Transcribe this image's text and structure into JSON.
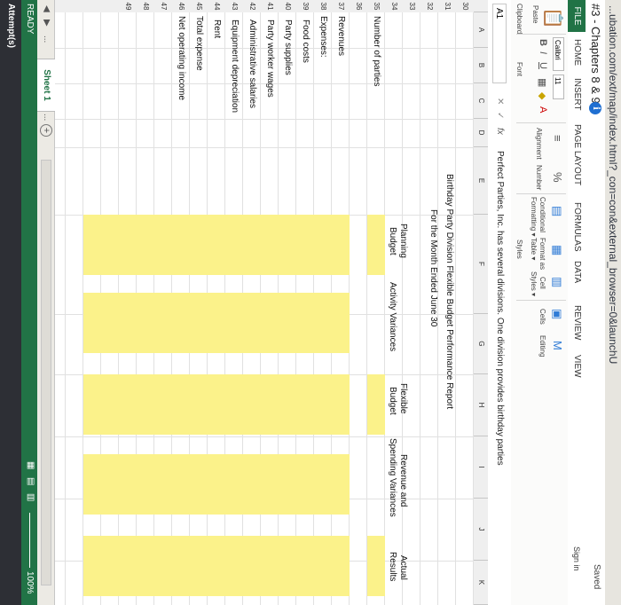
{
  "browser": {
    "url": "...ubation.com/ext/map/index.html?_con=con&external_browser=0&launchU"
  },
  "window": {
    "title": "#3 - Chapters 8 & 9",
    "info_glyph": "i",
    "saved": "Saved",
    "signin": "Sign in"
  },
  "ribbon_tabs": [
    "FILE",
    "HOME",
    "INSERT",
    "PAGE LAYOUT",
    "FORMULAS",
    "DATA",
    "REVIEW",
    "VIEW"
  ],
  "ribbon": {
    "paste": "Paste",
    "clipboard": "Clipboard",
    "font_name": "Calibri",
    "font_size": "11",
    "font_group": "Font",
    "bold": "B",
    "italic": "I",
    "underline": "U",
    "alignment": "Alignment",
    "number": "Number",
    "percent": "%",
    "conditional": "Conditional",
    "conditional2": "Formatting ▾",
    "format_as": "Format as",
    "format_as2": "Table ▾",
    "cell": "Cell",
    "cell2": "Styles ▾",
    "cells": "Cells",
    "editing": "Editing",
    "styles": "Styles"
  },
  "formula_bar": {
    "name_box": "A1",
    "fx": "fx",
    "cancel": "✕",
    "enter": "✓",
    "content": "Perfect Parties, Inc. has several divisions. One division provides birthday parties"
  },
  "columns": [
    "A",
    "B",
    "C",
    "D",
    "E",
    "F",
    "G",
    "H",
    "I",
    "J",
    "K"
  ],
  "rows": [
    "30",
    "31",
    "32",
    "33",
    "34",
    "35",
    "36",
    "37",
    "38",
    "39",
    "40",
    "41",
    "42",
    "43",
    "44",
    "45",
    "46",
    "47",
    "48",
    "49"
  ],
  "report": {
    "title": "Birthday Party Division Flexible Budget Performance Report",
    "subtitle": "For the Month Ended June 30",
    "headers": {
      "planning_1": "Planning",
      "planning_2": "Budget",
      "activity": "Activity Variances",
      "flexible_1": "Flexible",
      "flexible_2": "Budget",
      "revenue_1": "Revenue and",
      "revenue_2": "Spending Variances",
      "actual_1": "Actual",
      "actual_2": "Results"
    },
    "labels": {
      "parties": "Number of parties",
      "revenues": "Revenues",
      "expenses": "Expenses:",
      "food": "Food costs",
      "supplies": "Party supplies",
      "wages": "Party worker wages",
      "admin": "Administrative salaries",
      "depreciation": "Equipment depreciation",
      "rent": "Rent",
      "total": "Total expense",
      "noi": "Net operating income"
    }
  },
  "sheet": {
    "name": "Sheet 1",
    "more": "...",
    "add": "+"
  },
  "status": {
    "ready": "READY",
    "zoom": "100%"
  },
  "attempts": {
    "label": "Attempt(s)"
  },
  "colors": {
    "excel_green": "#217346",
    "input_yellow": "#fbf28a"
  }
}
